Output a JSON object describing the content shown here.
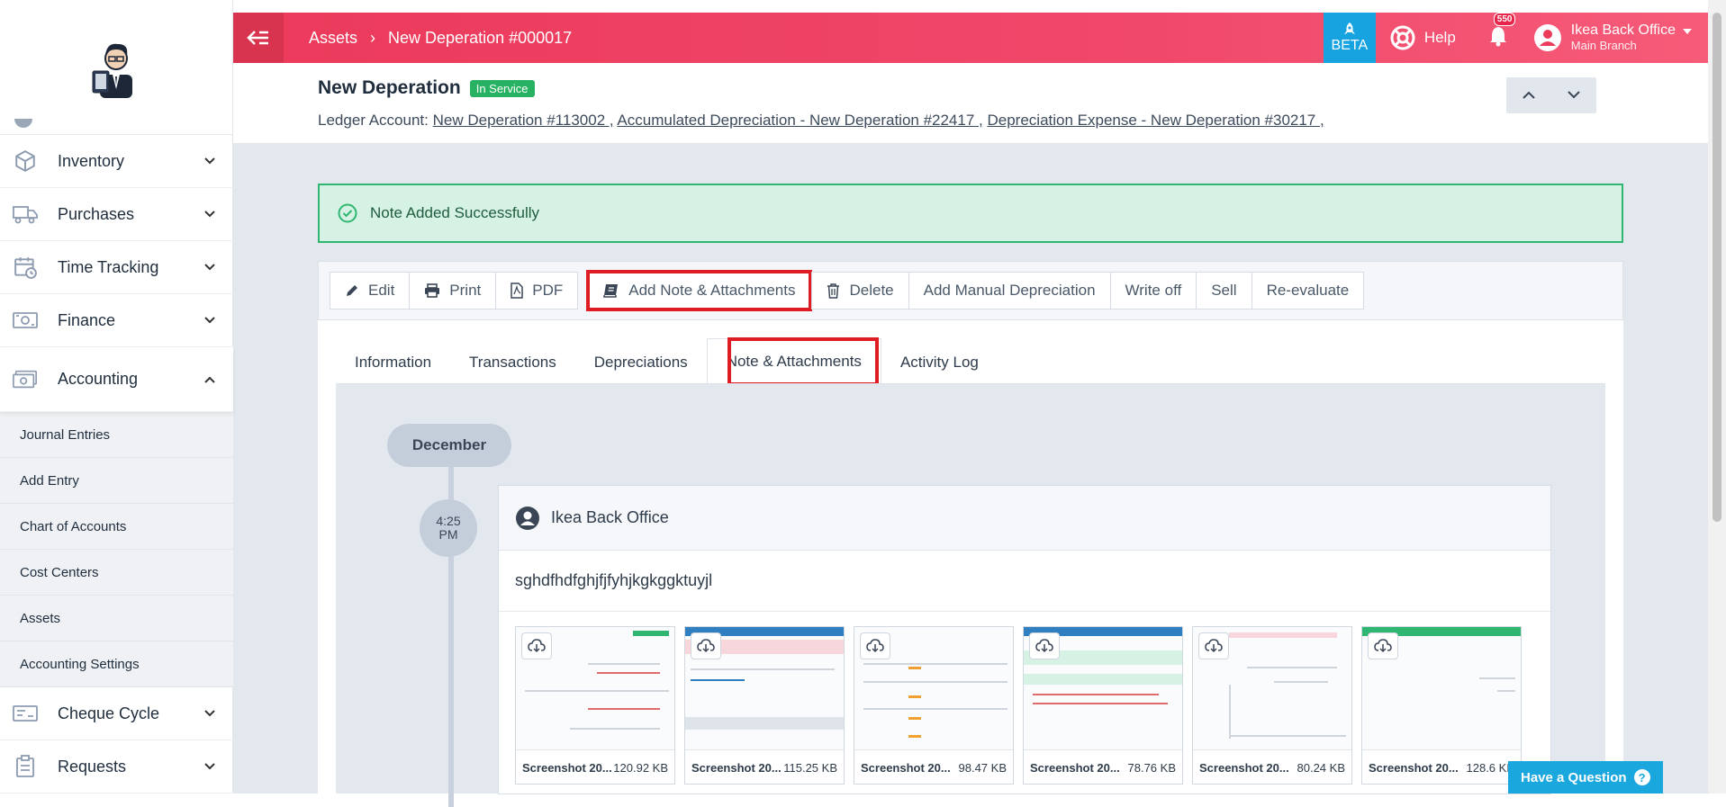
{
  "header": {
    "breadcrumbs": [
      "Assets",
      "New Deperation #000017"
    ],
    "beta_label": "BETA",
    "help_label": "Help",
    "notif_count": "550",
    "user_name": "Ikea Back Office",
    "branch": "Main Branch",
    "accent": "#ec3a5b"
  },
  "sidebar": {
    "items": [
      {
        "label": "Inventory",
        "icon": "box-icon"
      },
      {
        "label": "Purchases",
        "icon": "truck-icon"
      },
      {
        "label": "Time Tracking",
        "icon": "calendar-clock-icon"
      },
      {
        "label": "Finance",
        "icon": "money-icon"
      },
      {
        "label": "Accounting",
        "icon": "cash-icon"
      }
    ],
    "accounting_sub": [
      "Journal Entries",
      "Add Entry",
      "Chart of Accounts",
      "Cost Centers",
      "Assets",
      "Accounting Settings"
    ],
    "bottom_items": [
      {
        "label": "Cheque Cycle",
        "icon": "cheque-icon"
      },
      {
        "label": "Requests",
        "icon": "clipboard-icon"
      }
    ]
  },
  "page": {
    "title": "New Deperation",
    "status": "In Service",
    "ledger_label": "Ledger Account:",
    "ledger_links": [
      "New Deperation #113002 ,",
      "Accumulated Depreciation - New Deperation #22417 ,",
      "Depreciation Expense - New Deperation #30217 ,"
    ]
  },
  "alert": {
    "text": "Note Added Successfully",
    "color": "#2fb670"
  },
  "toolbar": {
    "edit": "Edit",
    "print": "Print",
    "pdf": "PDF",
    "add_note": "Add Note & Attachments",
    "delete": "Delete",
    "add_manual": "Add Manual Depreciation",
    "write_off": "Write off",
    "sell": "Sell",
    "reevaluate": "Re-evaluate"
  },
  "tabs": [
    "Information",
    "Transactions",
    "Depreciations",
    "Note & Attachments",
    "Activity Log"
  ],
  "timeline": {
    "month": "December",
    "time": "4:25",
    "ampm": "PM",
    "author": "Ikea Back Office",
    "note": "sghdfhdfghjfjfyhjkgkggktuyjl",
    "attachments": [
      {
        "name": "Screenshot 20...",
        "size": "120.92 KB"
      },
      {
        "name": "Screenshot 20...",
        "size": "115.25 KB"
      },
      {
        "name": "Screenshot 20...",
        "size": "98.47 KB"
      },
      {
        "name": "Screenshot 20...",
        "size": "78.76 KB"
      },
      {
        "name": "Screenshot 20...",
        "size": "80.24 KB"
      },
      {
        "name": "Screenshot 20...",
        "size": "128.6 KB"
      }
    ]
  },
  "help_button": "Have a Question"
}
